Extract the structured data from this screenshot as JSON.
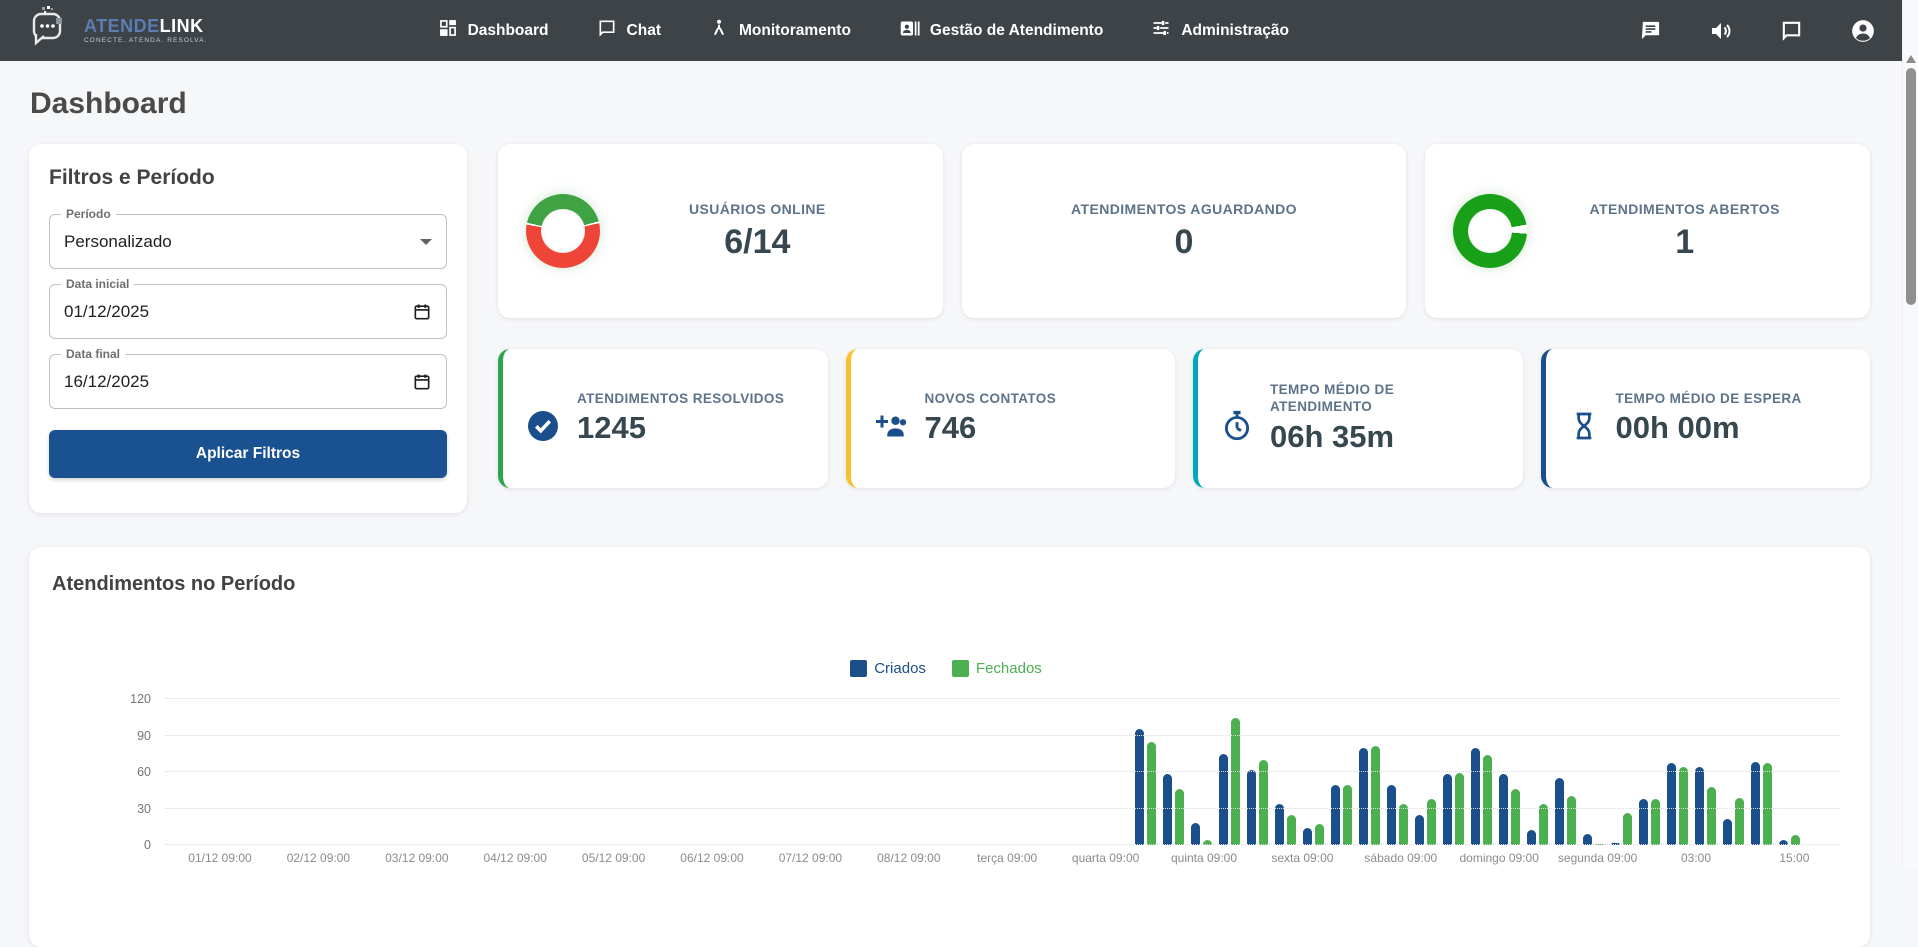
{
  "navbar": {
    "brand": {
      "name_primary": "ATENDE",
      "name_secondary": "LINK",
      "tagline": "CONECTE. ATENDA. RESOLVA.",
      "logo_icon": "speech-bubble-logo"
    },
    "items": [
      {
        "label": "Dashboard",
        "icon": "dashboard-grid-icon"
      },
      {
        "label": "Chat",
        "icon": "chat-outline-icon"
      },
      {
        "label": "Monitoramento",
        "icon": "person-monitor-icon"
      },
      {
        "label": "Gestão de Atendimento",
        "icon": "contact-card-icon"
      },
      {
        "label": "Administração",
        "icon": "tune-sliders-icon"
      }
    ],
    "right_icons": [
      "message-filled-icon",
      "volume-icon",
      "chat-outline-icon",
      "account-circle-icon"
    ]
  },
  "page": {
    "title": "Dashboard"
  },
  "filters": {
    "title": "Filtros e Período",
    "period": {
      "label": "Período",
      "value": "Personalizado"
    },
    "start_date": {
      "label": "Data inicial",
      "value": "01/12/2025"
    },
    "end_date": {
      "label": "Data final",
      "value": "16/12/2025"
    },
    "apply_button": "Aplicar Filtros"
  },
  "stats_top": [
    {
      "label": "USUÁRIOS ONLINE",
      "value": "6/14",
      "donut": {
        "green_pct": 43,
        "green": "#3fa344",
        "red": "#ef4438"
      }
    },
    {
      "label": "ATENDIMENTOS AGUARDANDO",
      "value": "0"
    },
    {
      "label": "ATENDIMENTOS ABERTOS",
      "value": "1",
      "donut": {
        "green_pct": 96,
        "green": "#18a018"
      }
    }
  ],
  "stats_small": [
    {
      "label": "ATENDIMENTOS RESOLVIDOS",
      "value": "1245",
      "accent": "#2da44e",
      "icon": "check-circle-icon"
    },
    {
      "label": "NOVOS CONTATOS",
      "value": "746",
      "accent": "#fbc02d",
      "icon": "group-add-icon"
    },
    {
      "label": "TEMPO MÉDIO DE ATENDIMENTO",
      "value": "06h 35m",
      "accent": "#00a9b7",
      "icon": "timer-icon"
    },
    {
      "label": "TEMPO MÉDIO DE ESPERA",
      "value": "00h 00m",
      "accent": "#1a4f8b",
      "icon": "hourglass-icon"
    }
  ],
  "chart_data": {
    "type": "bar",
    "title": "Atendimentos no Período",
    "ylim": [
      0,
      120
    ],
    "y_ticks": [
      0,
      30,
      60,
      90,
      120
    ],
    "grid": "horizontal-dotted",
    "legend_position": "top-center",
    "x_tick_labels": [
      "01/12 09:00",
      "02/12 09:00",
      "03/12 09:00",
      "04/12 09:00",
      "05/12 09:00",
      "06/12 09:00",
      "07/12 09:00",
      "08/12 09:00",
      "terça 09:00",
      "quarta 09:00",
      "quinta 09:00",
      "sexta 09:00",
      "sábado 09:00",
      "domingo 09:00",
      "segunda 09:00",
      "03:00",
      "15:00"
    ],
    "bars_alignment": "right-half-of-plot",
    "series": [
      {
        "name": "Criados",
        "color": "#1a4f8b",
        "values": [
          95,
          58,
          18,
          75,
          62,
          34,
          14,
          49,
          80,
          49,
          25,
          58,
          80,
          58,
          12,
          55,
          9,
          2,
          38,
          67,
          64,
          21,
          68,
          4
        ]
      },
      {
        "name": "Fechados",
        "color": "#4caf50",
        "values": [
          85,
          46,
          4,
          104,
          70,
          25,
          17,
          49,
          81,
          34,
          38,
          59,
          74,
          46,
          34,
          40,
          1,
          26,
          38,
          64,
          48,
          39,
          67,
          8
        ]
      }
    ]
  }
}
